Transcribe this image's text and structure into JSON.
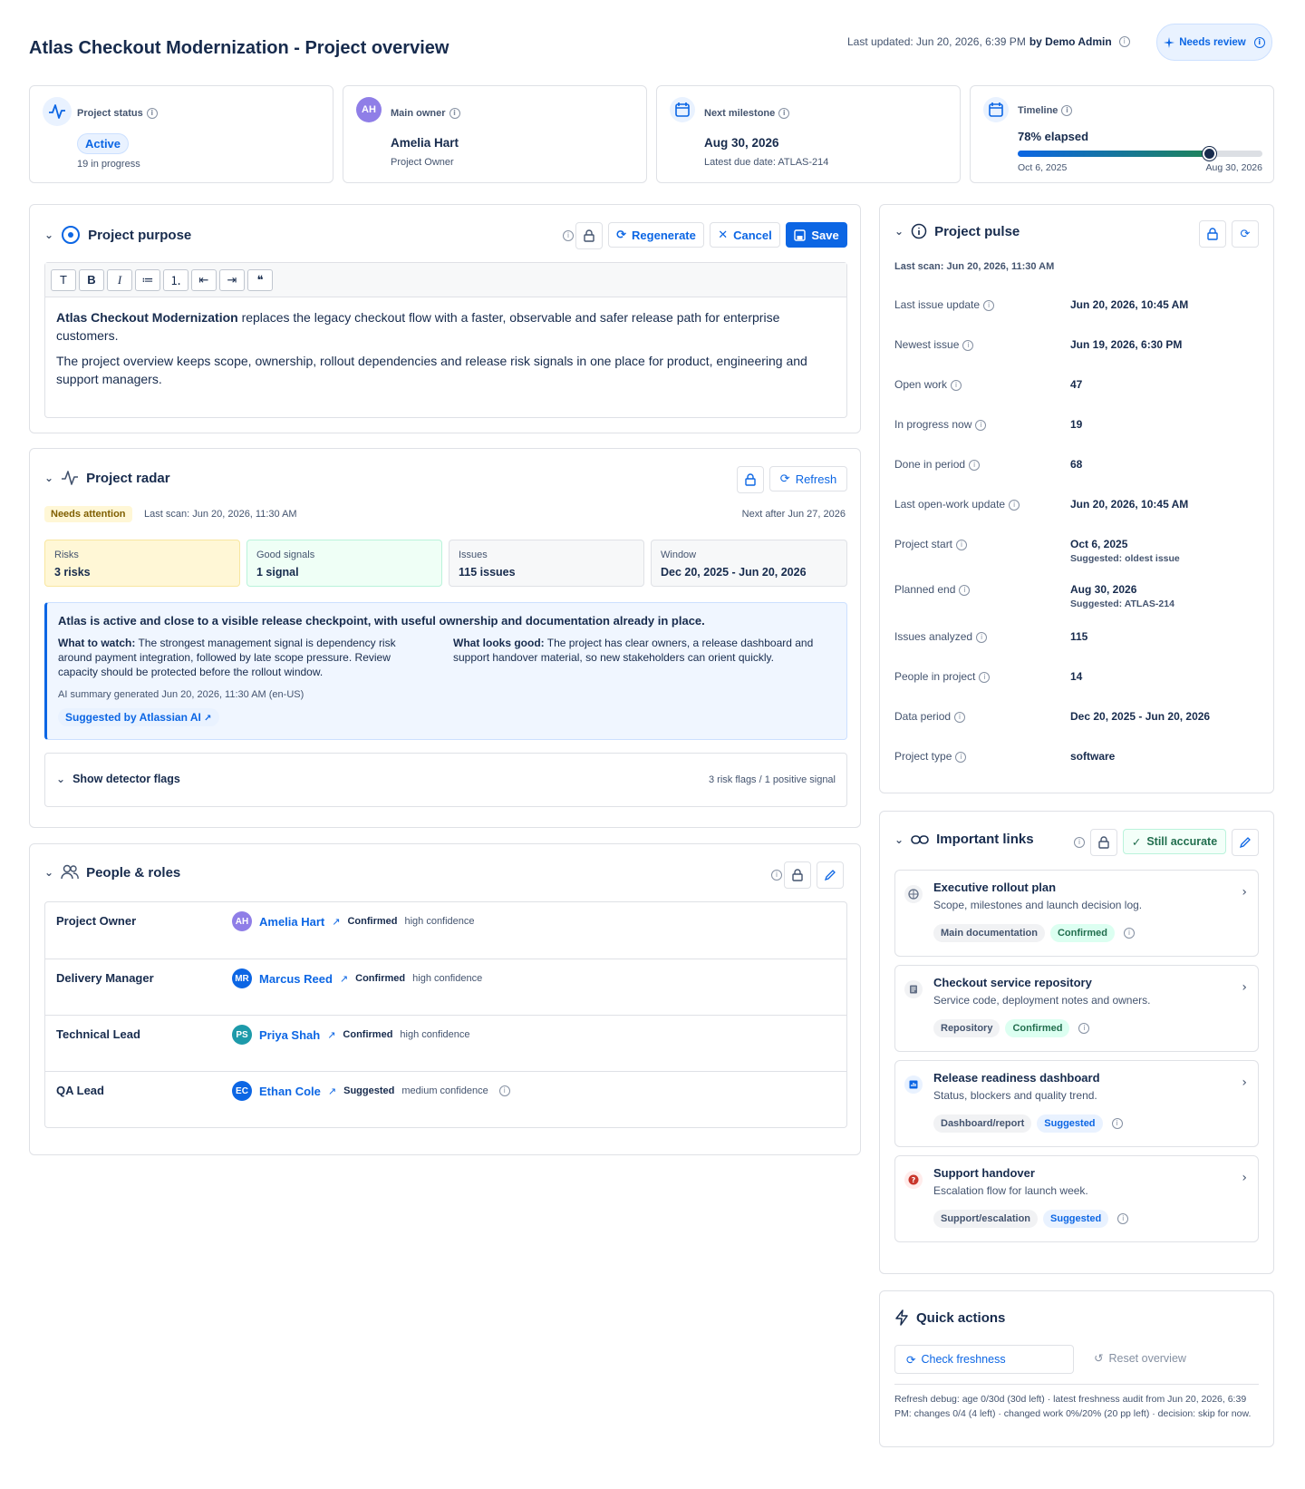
{
  "header": {
    "title": "Atlas Checkout Modernization - Project overview",
    "last_updated_label": "Last updated: Jun 20, 2026, 6:39 PM",
    "by_label": "by Demo Admin",
    "review_label": "Needs review"
  },
  "summary_cards": {
    "status": {
      "label": "Project status",
      "value": "Active",
      "sub": "19 in progress"
    },
    "owner": {
      "label": "Main owner",
      "initials": "AH",
      "name": "Amelia Hart",
      "role": "Project Owner"
    },
    "milestone": {
      "label": "Next milestone",
      "date": "Aug 30, 2026",
      "sub": "Latest due date: ATLAS-214"
    },
    "timeline": {
      "label": "Timeline",
      "elapsed_text": "78% elapsed",
      "elapsed_fraction": 0.78,
      "start": "Oct 6, 2025",
      "end": "Aug 30, 2026"
    }
  },
  "purpose": {
    "title": "Project purpose",
    "regenerate": "Regenerate",
    "cancel": "Cancel",
    "save": "Save",
    "toolbar": [
      "T",
      "B",
      "I",
      "≔",
      "⒈",
      "⇤",
      "⇥",
      "❝"
    ],
    "p1_bold": "Atlas Checkout Modernization",
    "p1_rest": " replaces the legacy checkout flow with a faster, observable and safer release path for enterprise customers.",
    "p2": "The project overview keeps scope, ownership, rollout dependencies and release risk signals in one place for product, engineering and support managers."
  },
  "radar": {
    "title": "Project radar",
    "refresh": "Refresh",
    "badge": "Needs attention",
    "last_scan": "Last scan: Jun 20, 2026, 11:30 AM",
    "next": "Next after Jun 27, 2026",
    "metrics": [
      {
        "label": "Risks",
        "value": "3 risks"
      },
      {
        "label": "Good signals",
        "value": "1 signal"
      },
      {
        "label": "Issues",
        "value": "115 issues"
      },
      {
        "label": "Window",
        "value": "Dec 20, 2025 - Jun 20, 2026"
      }
    ],
    "summary_headline": "Atlas is active and close to a visible release checkpoint, with useful ownership and documentation already in place.",
    "watch_label": "What to watch:",
    "watch_text": " The strongest management signal is dependency risk around payment integration, followed by late scope pressure. Review capacity should be protected before the rollout window.",
    "good_label": "What looks good:",
    "good_text": " The project has clear owners, a release dashboard and support handover material, so new stakeholders can orient quickly.",
    "generated": "AI summary generated Jun 20, 2026, 11:30 AM (en-US)",
    "suggested_by": "Suggested by Atlassian AI",
    "flags_toggle": "Show detector flags",
    "flags_count": "3 risk flags / 1 positive signal"
  },
  "people": {
    "title": "People & roles",
    "rows": [
      {
        "role": "Project Owner",
        "initials": "AH",
        "color": "#8f7ee7",
        "name": "Amelia Hart",
        "status": "Confirmed",
        "confidence": "high confidence"
      },
      {
        "role": "Delivery Manager",
        "initials": "MR",
        "color": "#0c66e4",
        "name": "Marcus Reed",
        "status": "Confirmed",
        "confidence": "high confidence"
      },
      {
        "role": "Technical Lead",
        "initials": "PS",
        "color": "#1d9aaa",
        "name": "Priya Shah",
        "status": "Confirmed",
        "confidence": "high confidence"
      },
      {
        "role": "QA Lead",
        "initials": "EC",
        "color": "#0c66e4",
        "name": "Ethan Cole",
        "status": "Suggested",
        "confidence": "medium confidence"
      }
    ]
  },
  "pulse": {
    "title": "Project pulse",
    "last_scan": "Last scan: Jun 20, 2026, 11:30 AM",
    "rows": [
      {
        "key": "Last issue update",
        "value": "Jun 20, 2026, 10:45 AM"
      },
      {
        "key": "Newest issue",
        "value": "Jun 19, 2026, 6:30 PM"
      },
      {
        "key": "Open work",
        "value": "47"
      },
      {
        "key": "In progress now",
        "value": "19"
      },
      {
        "key": "Done in period",
        "value": "68"
      },
      {
        "key": "Last open-work update",
        "value": "Jun 20, 2026, 10:45 AM"
      },
      {
        "key": "Project start",
        "value": "Oct 6, 2025",
        "sub": "Suggested: oldest issue"
      },
      {
        "key": "Planned end",
        "value": "Aug 30, 2026",
        "sub": "Suggested: ATLAS-214"
      },
      {
        "key": "Issues analyzed",
        "value": "115"
      },
      {
        "key": "People in project",
        "value": "14"
      },
      {
        "key": "Data period",
        "value": "Dec 20, 2025 - Jun 20, 2026"
      },
      {
        "key": "Project type",
        "value": "software"
      }
    ]
  },
  "links": {
    "title": "Important links",
    "still_accurate": "Still accurate",
    "items": [
      {
        "title": "Executive rollout plan",
        "desc": "Scope, milestones and launch decision log.",
        "type": "Main documentation",
        "status": "Confirmed",
        "icon": "globe-icon"
      },
      {
        "title": "Checkout service repository",
        "desc": "Service code, deployment notes and owners.",
        "type": "Repository",
        "status": "Confirmed",
        "icon": "repo-icon"
      },
      {
        "title": "Release readiness dashboard",
        "desc": "Status, blockers and quality trend.",
        "type": "Dashboard/report",
        "status": "Suggested",
        "icon": "chart-icon"
      },
      {
        "title": "Support handover",
        "desc": "Escalation flow for launch week.",
        "type": "Support/escalation",
        "status": "Suggested",
        "icon": "help-icon"
      }
    ]
  },
  "quick_actions": {
    "title": "Quick actions",
    "check": "Check freshness",
    "reset": "Reset overview",
    "debug": "Refresh debug: age 0/30d (30d left) · latest freshness audit from Jun 20, 2026, 6:39 PM: changes 0/4 (4 left) · changed work 0%/20% (20 pp left) · decision: skip for now."
  },
  "colors": {
    "accent": "#0c66e4",
    "border": "#dfe1e6",
    "text": "#172b4d",
    "muted": "#44546f"
  }
}
